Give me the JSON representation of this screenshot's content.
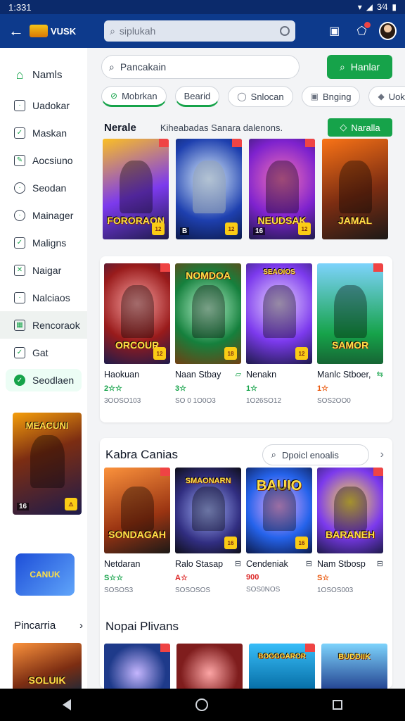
{
  "status": {
    "time": "1:331",
    "right": "3⁄4"
  },
  "appbar": {
    "brand": "VUSK",
    "search_placeholder": "siplukah"
  },
  "sidebar": {
    "items": [
      {
        "label": "Namls",
        "icon": "home-icon"
      },
      {
        "label": "Uadokar",
        "icon": "list-icon"
      },
      {
        "label": "Maskan",
        "icon": "check-icon"
      },
      {
        "label": "Aocsiuno",
        "icon": "edit-icon"
      },
      {
        "label": "Seodan",
        "icon": "chat-icon"
      },
      {
        "label": "Mainager",
        "icon": "dot-icon"
      },
      {
        "label": "Maligns",
        "icon": "check-icon"
      },
      {
        "label": "Naigar",
        "icon": "close-box-icon"
      },
      {
        "label": "Nalciaos",
        "icon": "chat-box-icon"
      },
      {
        "label": "Rencoraok",
        "icon": "grid-icon"
      },
      {
        "label": "Gat",
        "icon": "check-icon"
      },
      {
        "label": "Seodlaen",
        "icon": "leaf-icon"
      }
    ],
    "poster_title": "MEACUNI",
    "poster_age": "16",
    "logo_text": "CANUK",
    "pincarria": "Pincarria",
    "poster2_title": "SOLUIK"
  },
  "main": {
    "search_placeholder": "Pancakain",
    "search_button": "Hanlar",
    "chips": [
      {
        "label": "Mobrkan",
        "icon": "leaf-icon"
      },
      {
        "label": "Bearid",
        "icon": ""
      },
      {
        "label": "Snlocan",
        "icon": "chat-icon"
      },
      {
        "label": "Bnging",
        "icon": "box-icon"
      },
      {
        "label": "Uok",
        "icon": "tag-icon"
      }
    ],
    "section1": {
      "title": "Nerale",
      "subtitle": "Kiheabadas Sanara dalenons.",
      "button": "Naralla"
    },
    "row1": [
      {
        "title": "FORORAON",
        "age": "12",
        "badge": ""
      },
      {
        "title": "",
        "age": "12",
        "badge": "B"
      },
      {
        "title": "NEUDSAK",
        "age": "12",
        "badge": "16"
      },
      {
        "title": "JAMAL",
        "age": "",
        "badge": ""
      }
    ],
    "row2": [
      {
        "title": "Haokuan",
        "stars": "2☆☆",
        "sub": "3OOSO103",
        "poster": "ORCOUR"
      },
      {
        "title": "Naan Stbay",
        "stars": "3☆",
        "sub": "SO 0 1O0O3",
        "poster": "NOMDOA",
        "mini": "▱"
      },
      {
        "title": "Nenakn",
        "stars": "1☆",
        "sub": "1O26SO12",
        "poster": "SEAOIOS"
      },
      {
        "title": "Manlc Stboer,",
        "stars": "1☆",
        "sub": "SOS2OO0",
        "poster": "SAMOR",
        "mini": "⇆"
      }
    ],
    "section2": {
      "title": "Kabra Canias",
      "search": "Dpoicl enoalis"
    },
    "row3": [
      {
        "title": "Netdaran",
        "stars": "S☆☆",
        "sub": "SOSOS3",
        "poster": "SONDAGAH"
      },
      {
        "title": "Ralo Stasap",
        "stars": "A☆",
        "sub": "SOSOSOS",
        "poster": "SMAONARN",
        "mini": "⊟"
      },
      {
        "title": "Cendeniak",
        "stars": "900",
        "sub": "SOS0NOS",
        "poster": "BAUIO",
        "mini": "⊟"
      },
      {
        "title": "Nam Stbosp",
        "stars": "S☆",
        "sub": "1OSOS003",
        "poster": "BARANEH",
        "mini": "⊟"
      }
    ],
    "section3": {
      "title": "Nopai Plivans"
    },
    "row4": [
      {
        "poster": ""
      },
      {
        "poster": ""
      },
      {
        "poster": "BOGGGAROR"
      },
      {
        "poster": "BUDDIIK"
      }
    ]
  }
}
